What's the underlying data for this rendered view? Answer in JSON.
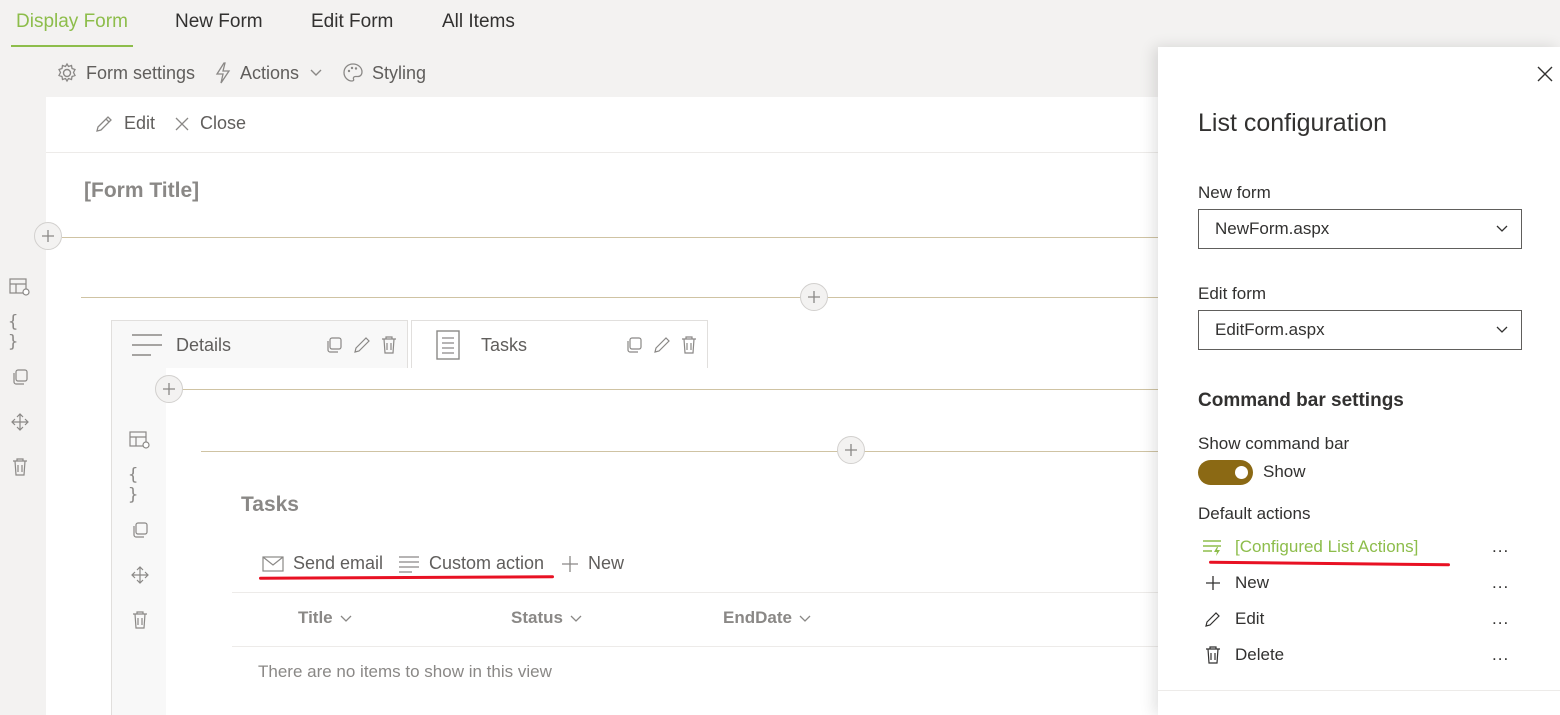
{
  "top_tabs": [
    {
      "label": "Display Form",
      "active": true
    },
    {
      "label": "New Form",
      "active": false
    },
    {
      "label": "Edit Form",
      "active": false
    },
    {
      "label": "All Items",
      "active": false
    }
  ],
  "toolbar": {
    "form_settings": "Form settings",
    "actions": "Actions",
    "styling": "Styling"
  },
  "command_bar": {
    "edit": "Edit",
    "close": "Close"
  },
  "form_title": "[Form Title]",
  "tabs": [
    {
      "label": "Details"
    },
    {
      "label": "Tasks"
    }
  ],
  "list": {
    "title": "Tasks",
    "commands": [
      "Send email",
      "Custom action",
      "New"
    ],
    "columns": [
      "Title",
      "Status",
      "EndDate"
    ],
    "empty_text": "There are no items to show in this view"
  },
  "panel": {
    "title": "List configuration",
    "new_form_label": "New form",
    "new_form_value": "NewForm.aspx",
    "edit_form_label": "Edit form",
    "edit_form_value": "EditForm.aspx",
    "command_bar_title": "Command bar settings",
    "show_command_bar_label": "Show command bar",
    "show_toggle_text": "Show",
    "show_toggle_on": true,
    "default_actions_label": "Default actions",
    "actions": [
      {
        "label": "[Configured List Actions]",
        "icon": "configured-actions-icon",
        "more": "..."
      },
      {
        "label": "New",
        "icon": "plus-icon",
        "more": "..."
      },
      {
        "label": "Edit",
        "icon": "pencil-icon",
        "more": "..."
      },
      {
        "label": "Delete",
        "icon": "trash-icon",
        "more": "..."
      }
    ]
  },
  "colors": {
    "accent_green": "#8dbd4b",
    "toggle_brown": "#8b6914",
    "highlight_red": "#e81123",
    "divider_gold": "#cfc3a3"
  }
}
